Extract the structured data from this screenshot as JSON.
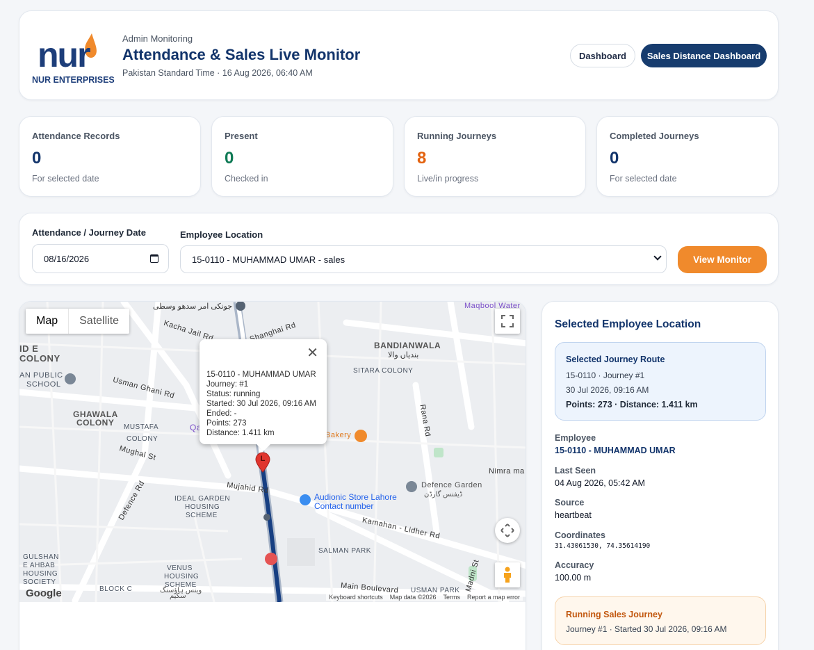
{
  "header": {
    "logo_text": "nur",
    "logo_subtext": "NUR ENTERPRISES",
    "subtitle": "Admin Monitoring",
    "title": "Attendance & Sales Live Monitor",
    "timestamp": "Pakistan Standard Time · 16 Aug 2026, 06:40 AM",
    "buttons": {
      "dashboard": "Dashboard",
      "sales_distance": "Sales Distance Dashboard"
    }
  },
  "stats": [
    {
      "label": "Attendance Records",
      "value": "0",
      "note": "For selected date",
      "color": "#12346b"
    },
    {
      "label": "Present",
      "value": "0",
      "note": "Checked in",
      "color": "#0f7a55"
    },
    {
      "label": "Running Journeys",
      "value": "8",
      "note": "Live/in progress",
      "color": "#e3620f"
    },
    {
      "label": "Completed Journeys",
      "value": "0",
      "note": "For selected date",
      "color": "#12346b"
    }
  ],
  "filters": {
    "date_label": "Attendance / Journey Date",
    "date_value": "08/16/2026",
    "employee_label": "Employee Location",
    "employee_selected": "15-0110 - MUHAMMAD UMAR - sales",
    "submit_label": "View Monitor"
  },
  "map": {
    "type_buttons": {
      "map": "Map",
      "satellite": "Satellite"
    },
    "marker_label": "L",
    "popup": {
      "title": "15-0110 - MUHAMMAD UMAR",
      "lines": [
        "Journey: #1",
        "Status: running",
        "Started: 30 Jul 2026, 09:16 AM",
        "Ended: -",
        "Points: 273",
        "Distance: 1.411 km"
      ]
    },
    "place_labels": {
      "maqbool": "Maqbool Water",
      "urdu_top": "جونکی امر سدھو وسطی",
      "kacha": "Kacha Jail Rd",
      "shanghai": "Shanghai Rd",
      "bandianwala": "BANDIANWALA",
      "bandianwala_urdu": "بندیاں والا",
      "id_e": "ID E",
      "colony": "COLONY",
      "public_school_1": "AN PUBLIC",
      "public_school_2": "SCHOOL",
      "usman_ghani": "Usman Ghani Rd",
      "sitara": "SITARA COLONY",
      "ghawala_1": "GHAWALA",
      "ghawala_2": "COLONY",
      "mustafa_1": "MUSTAFA",
      "mustafa_2": "COLONY",
      "mughal": "Mughal St",
      "rana": "Rana Rd",
      "bakery": "Bakery",
      "qa": "Qa",
      "nimra": "Nimra ma",
      "mujahid": "Mujahid Rd",
      "defence_garden": "Defence Garden",
      "defence_garden_urdu": "ڈیفنس گارڈن",
      "defence_rd": "Defence Rd",
      "ideal_1": "IDEAL GARDEN",
      "ideal_2": "HOUSING",
      "ideal_3": "SCHEME",
      "audionic_1": "Audionic Store Lahore",
      "audionic_2": "Contact number",
      "kamahan": "Kamahan - Lidher Rd",
      "salman": "SALMAN PARK",
      "gulshan_1": "GULSHAN",
      "gulshan_2": "E AHBAB",
      "gulshan_3": "HOUSING",
      "gulshan_4": "SOCIETY",
      "venus_1": "VENUS",
      "venus_2": "HOUSING",
      "venus_3": "SCHEME",
      "venus_urdu": "وینس ہاؤسنگ",
      "venus_urdu_2": "سکیم",
      "block_c": "BLOCK C",
      "main_boulevard": "Main Boulevard",
      "usman_park": "USMAN PARK",
      "madni": "Madni St"
    },
    "google": "Google",
    "attribution": {
      "shortcuts": "Keyboard shortcuts",
      "data": "Map data ©2026",
      "terms": "Terms",
      "report": "Report a map error"
    }
  },
  "side": {
    "title": "Selected Employee Location",
    "route": {
      "title": "Selected Journey Route",
      "line1": "15-0110 · Journey #1",
      "line2": "30 Jul 2026, 09:16 AM",
      "line3": "Points: 273 · Distance: 1.411 km"
    },
    "fields": {
      "employee_label": "Employee",
      "employee_value": "15-0110 - MUHAMMAD UMAR",
      "last_seen_label": "Last Seen",
      "last_seen_value": "04 Aug 2026, 05:42 AM",
      "source_label": "Source",
      "source_value": "heartbeat",
      "coords_label": "Coordinates",
      "coords_value": "31.43061530, 74.35614190",
      "accuracy_label": "Accuracy",
      "accuracy_value": "100.00 m"
    },
    "journey": {
      "title": "Running Sales Journey",
      "detail": "Journey #1 · Started 30 Jul 2026, 09:16 AM"
    }
  }
}
